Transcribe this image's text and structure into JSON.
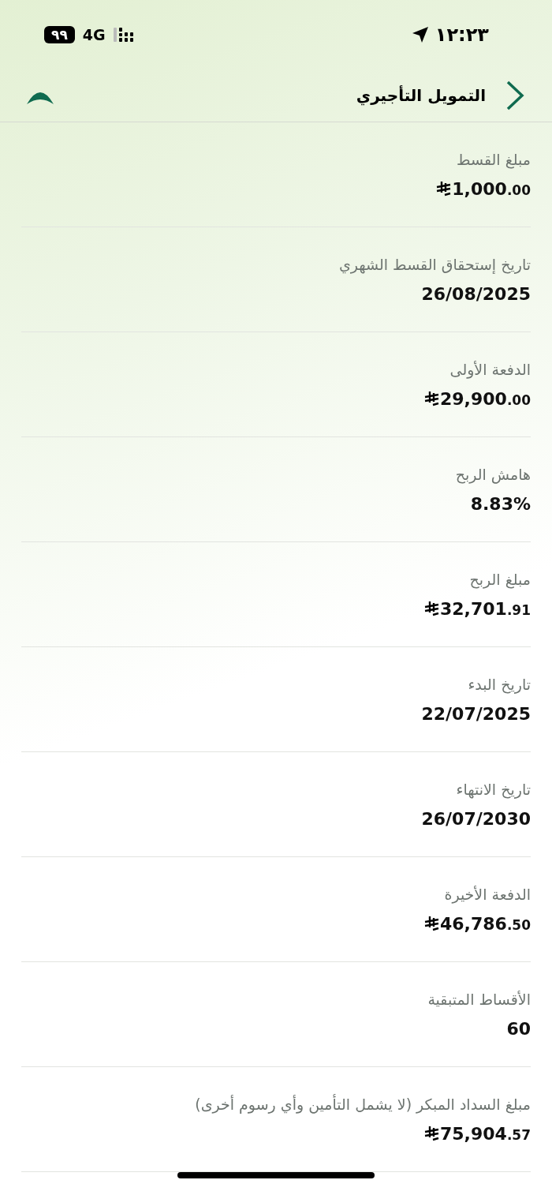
{
  "status_bar": {
    "time": "١٢:٢٣",
    "battery": "٩٩",
    "network": "4G"
  },
  "header": {
    "title": "التمويل التأجيري"
  },
  "fields": [
    {
      "label": "مبلغ القسط",
      "value": "1,000.00",
      "kind": "money"
    },
    {
      "label": "تاريخ إستحقاق القسط الشهري",
      "value": "26/08/2025",
      "kind": "text"
    },
    {
      "label": "الدفعة الأولى",
      "value": "29,900.00",
      "kind": "money"
    },
    {
      "label": "هامش الربح",
      "value": "8.83%",
      "kind": "text"
    },
    {
      "label": "مبلغ الربح",
      "value": "32,701.91",
      "kind": "money"
    },
    {
      "label": "تاريخ البدء",
      "value": "22/07/2025",
      "kind": "text"
    },
    {
      "label": "تاريخ الانتهاء",
      "value": "26/07/2030",
      "kind": "text"
    },
    {
      "label": "الدفعة الأخيرة",
      "value": "46,786.50",
      "kind": "money"
    },
    {
      "label": "الأقساط المتبقية",
      "value": "60",
      "kind": "text"
    },
    {
      "label": "مبلغ السداد المبكر (لا يشمل التأمين وأي رسوم أخرى)",
      "value": "75,904.57",
      "kind": "money"
    }
  ]
}
